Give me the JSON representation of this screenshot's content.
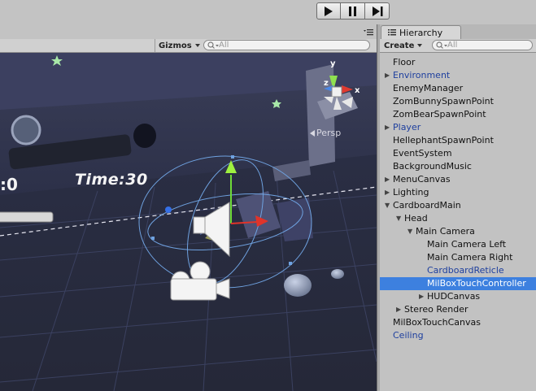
{
  "toolbar": {
    "play_icon": "play-icon",
    "pause_icon": "pause-icon",
    "step_icon": "step-icon"
  },
  "scene": {
    "gizmos_label": "Gizmos",
    "search_placeholder": "All",
    "hud_time": "Time:30",
    "hud_score": ":0",
    "view_label": "Persp",
    "axis_labels": {
      "x": "x",
      "y": "y",
      "z": "z"
    }
  },
  "hierarchy": {
    "tab_label": "Hierarchy",
    "create_label": "Create",
    "search_placeholder": "All",
    "items": [
      {
        "label": "Floor",
        "depth": 0,
        "arrow": "",
        "style": "normal"
      },
      {
        "label": "Environment",
        "depth": 0,
        "arrow": "collapsed",
        "style": "prefab"
      },
      {
        "label": "EnemyManager",
        "depth": 0,
        "arrow": "",
        "style": "normal"
      },
      {
        "label": "ZomBunnySpawnPoint",
        "depth": 0,
        "arrow": "",
        "style": "normal"
      },
      {
        "label": "ZomBearSpawnPoint",
        "depth": 0,
        "arrow": "",
        "style": "normal"
      },
      {
        "label": "Player",
        "depth": 0,
        "arrow": "collapsed",
        "style": "prefab"
      },
      {
        "label": "HellephantSpawnPoint",
        "depth": 0,
        "arrow": "",
        "style": "normal"
      },
      {
        "label": "EventSystem",
        "depth": 0,
        "arrow": "",
        "style": "normal"
      },
      {
        "label": "BackgroundMusic",
        "depth": 0,
        "arrow": "",
        "style": "normal"
      },
      {
        "label": "MenuCanvas",
        "depth": 0,
        "arrow": "collapsed",
        "style": "normal"
      },
      {
        "label": "Lighting",
        "depth": 0,
        "arrow": "collapsed",
        "style": "normal"
      },
      {
        "label": "CardboardMain",
        "depth": 0,
        "arrow": "expanded",
        "style": "normal"
      },
      {
        "label": "Head",
        "depth": 1,
        "arrow": "expanded",
        "style": "normal"
      },
      {
        "label": "Main Camera",
        "depth": 2,
        "arrow": "expanded",
        "style": "normal"
      },
      {
        "label": "Main Camera Left",
        "depth": 3,
        "arrow": "",
        "style": "normal"
      },
      {
        "label": "Main Camera Right",
        "depth": 3,
        "arrow": "",
        "style": "normal"
      },
      {
        "label": "CardboardReticle",
        "depth": 3,
        "arrow": "",
        "style": "prefab"
      },
      {
        "label": "MilBoxTouchController",
        "depth": 3,
        "arrow": "",
        "style": "selected"
      },
      {
        "label": "HUDCanvas",
        "depth": 3,
        "arrow": "collapsed",
        "style": "normal"
      },
      {
        "label": "Stereo Render",
        "depth": 1,
        "arrow": "collapsed",
        "style": "normal"
      },
      {
        "label": "MilBoxTouchCanvas",
        "depth": 0,
        "arrow": "",
        "style": "normal"
      },
      {
        "label": "Ceiling",
        "depth": 0,
        "arrow": "",
        "style": "prefab"
      }
    ]
  },
  "colors": {
    "selection": "#3d80df",
    "prefab_text": "#1e3f9e",
    "panel_bg": "#c2c2c2",
    "scene_bg": "#2f3347"
  }
}
